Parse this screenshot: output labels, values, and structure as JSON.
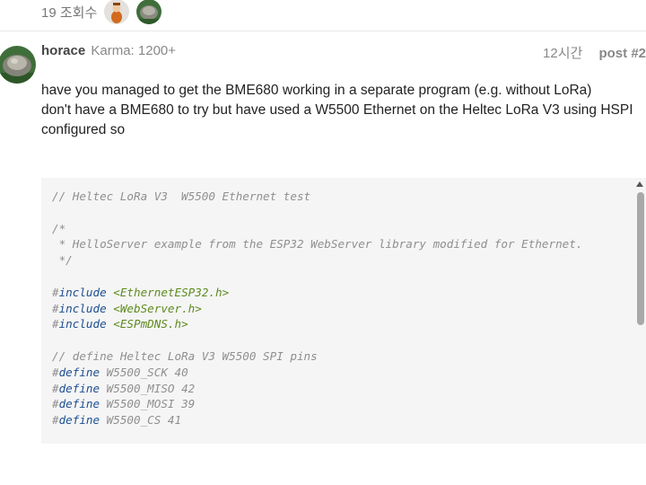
{
  "topic": {
    "views_label": "19 조회수"
  },
  "post": {
    "username": "horace",
    "karma": "Karma: 1200+",
    "time": "12시간",
    "number": "post #2",
    "paragraphs": [
      "have you managed to get the BME680 working in a separate program (e.g. without LoRa)",
      "don't have a BME680 to try but have used a W5500 Ethernet on the Heltec LoRa V3 using HSPI",
      "configured so"
    ]
  },
  "code": {
    "lines": [
      [
        [
          "comment",
          "// Heltec LoRa V3  W5500 Ethernet test"
        ]
      ],
      [],
      [
        [
          "comment",
          "/*"
        ]
      ],
      [
        [
          "comment",
          " * HelloServer example from the ESP32 WebServer library modified for Ethernet."
        ]
      ],
      [
        [
          "comment",
          " */"
        ]
      ],
      [],
      [
        [
          "hash",
          "#"
        ],
        [
          "kw",
          "include"
        ],
        [
          "plain",
          " "
        ],
        [
          "str",
          "<EthernetESP32.h>"
        ]
      ],
      [
        [
          "hash",
          "#"
        ],
        [
          "kw",
          "include"
        ],
        [
          "plain",
          " "
        ],
        [
          "str",
          "<WebServer.h>"
        ]
      ],
      [
        [
          "hash",
          "#"
        ],
        [
          "kw",
          "include"
        ],
        [
          "plain",
          " "
        ],
        [
          "str",
          "<ESPmDNS.h>"
        ]
      ],
      [],
      [
        [
          "comment",
          "// define Heltec LoRa V3 W5500 SPI pins"
        ]
      ],
      [
        [
          "hash",
          "#"
        ],
        [
          "kw",
          "define"
        ],
        [
          "plain",
          " W5500_SCK 40"
        ]
      ],
      [
        [
          "hash",
          "#"
        ],
        [
          "kw",
          "define"
        ],
        [
          "plain",
          " W5500_MISO 42"
        ]
      ],
      [
        [
          "hash",
          "#"
        ],
        [
          "kw",
          "define"
        ],
        [
          "plain",
          " W5500_MOSI 39"
        ]
      ],
      [
        [
          "hash",
          "#"
        ],
        [
          "kw",
          "define"
        ],
        [
          "plain",
          " W5500_CS 41"
        ]
      ]
    ]
  }
}
